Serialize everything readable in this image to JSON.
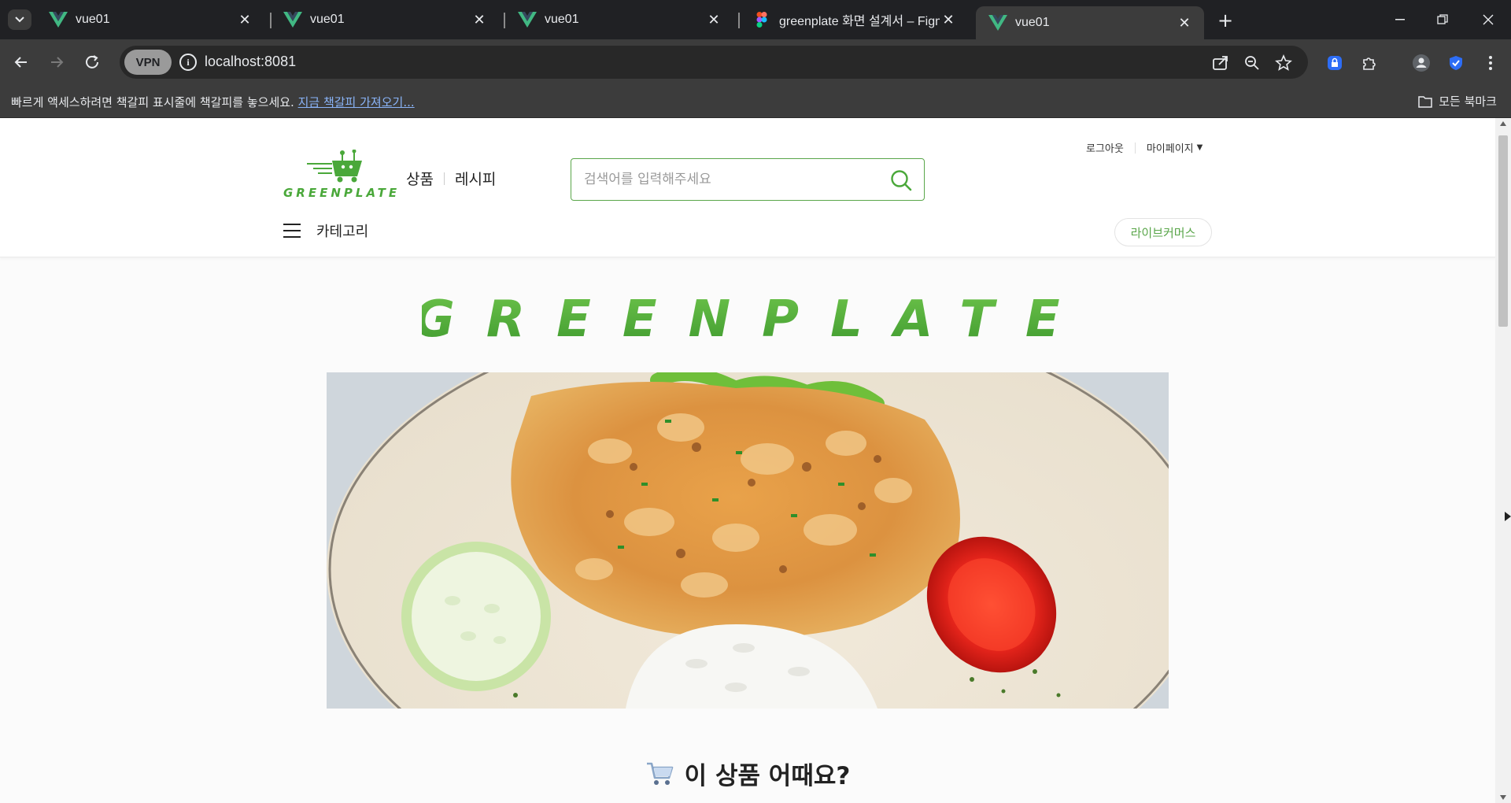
{
  "browser": {
    "tabs": [
      {
        "title": "vue01",
        "favicon": "vue-icon",
        "active": false
      },
      {
        "title": "vue01",
        "favicon": "vue-icon",
        "active": false
      },
      {
        "title": "vue01",
        "favicon": "vue-icon",
        "active": false
      },
      {
        "title": "greenplate 화면 설계서 – Figma",
        "favicon": "figma-icon",
        "active": false
      },
      {
        "title": "vue01",
        "favicon": "vue-icon",
        "active": true
      }
    ],
    "vpn_label": "VPN",
    "url": "localhost:8081",
    "bookmark_prompt": "빠르게 액세스하려면 책갈피 표시줄에 책갈피를 놓으세요.",
    "bookmark_link": "지금 책갈피 가져오기...",
    "all_bookmarks": "모든 북마크"
  },
  "site": {
    "logo_text": "GREENPLATE",
    "top_links": {
      "logout": "로그아웃",
      "mypage": "마이페이지"
    },
    "nav": {
      "products": "상품",
      "recipes": "레시피"
    },
    "search_placeholder": "검색어를 입력해주세요",
    "category_label": "카테고리",
    "live_commerce": "라이브커머스",
    "banner_logo": "GREENPLATE",
    "section_title": "이 상품 어때요?",
    "section_icon": "cart-icon"
  },
  "colors": {
    "brand_green": "#5aa64a",
    "chrome_dark": "#202124",
    "chrome_toolbar": "#3c3c3c"
  }
}
